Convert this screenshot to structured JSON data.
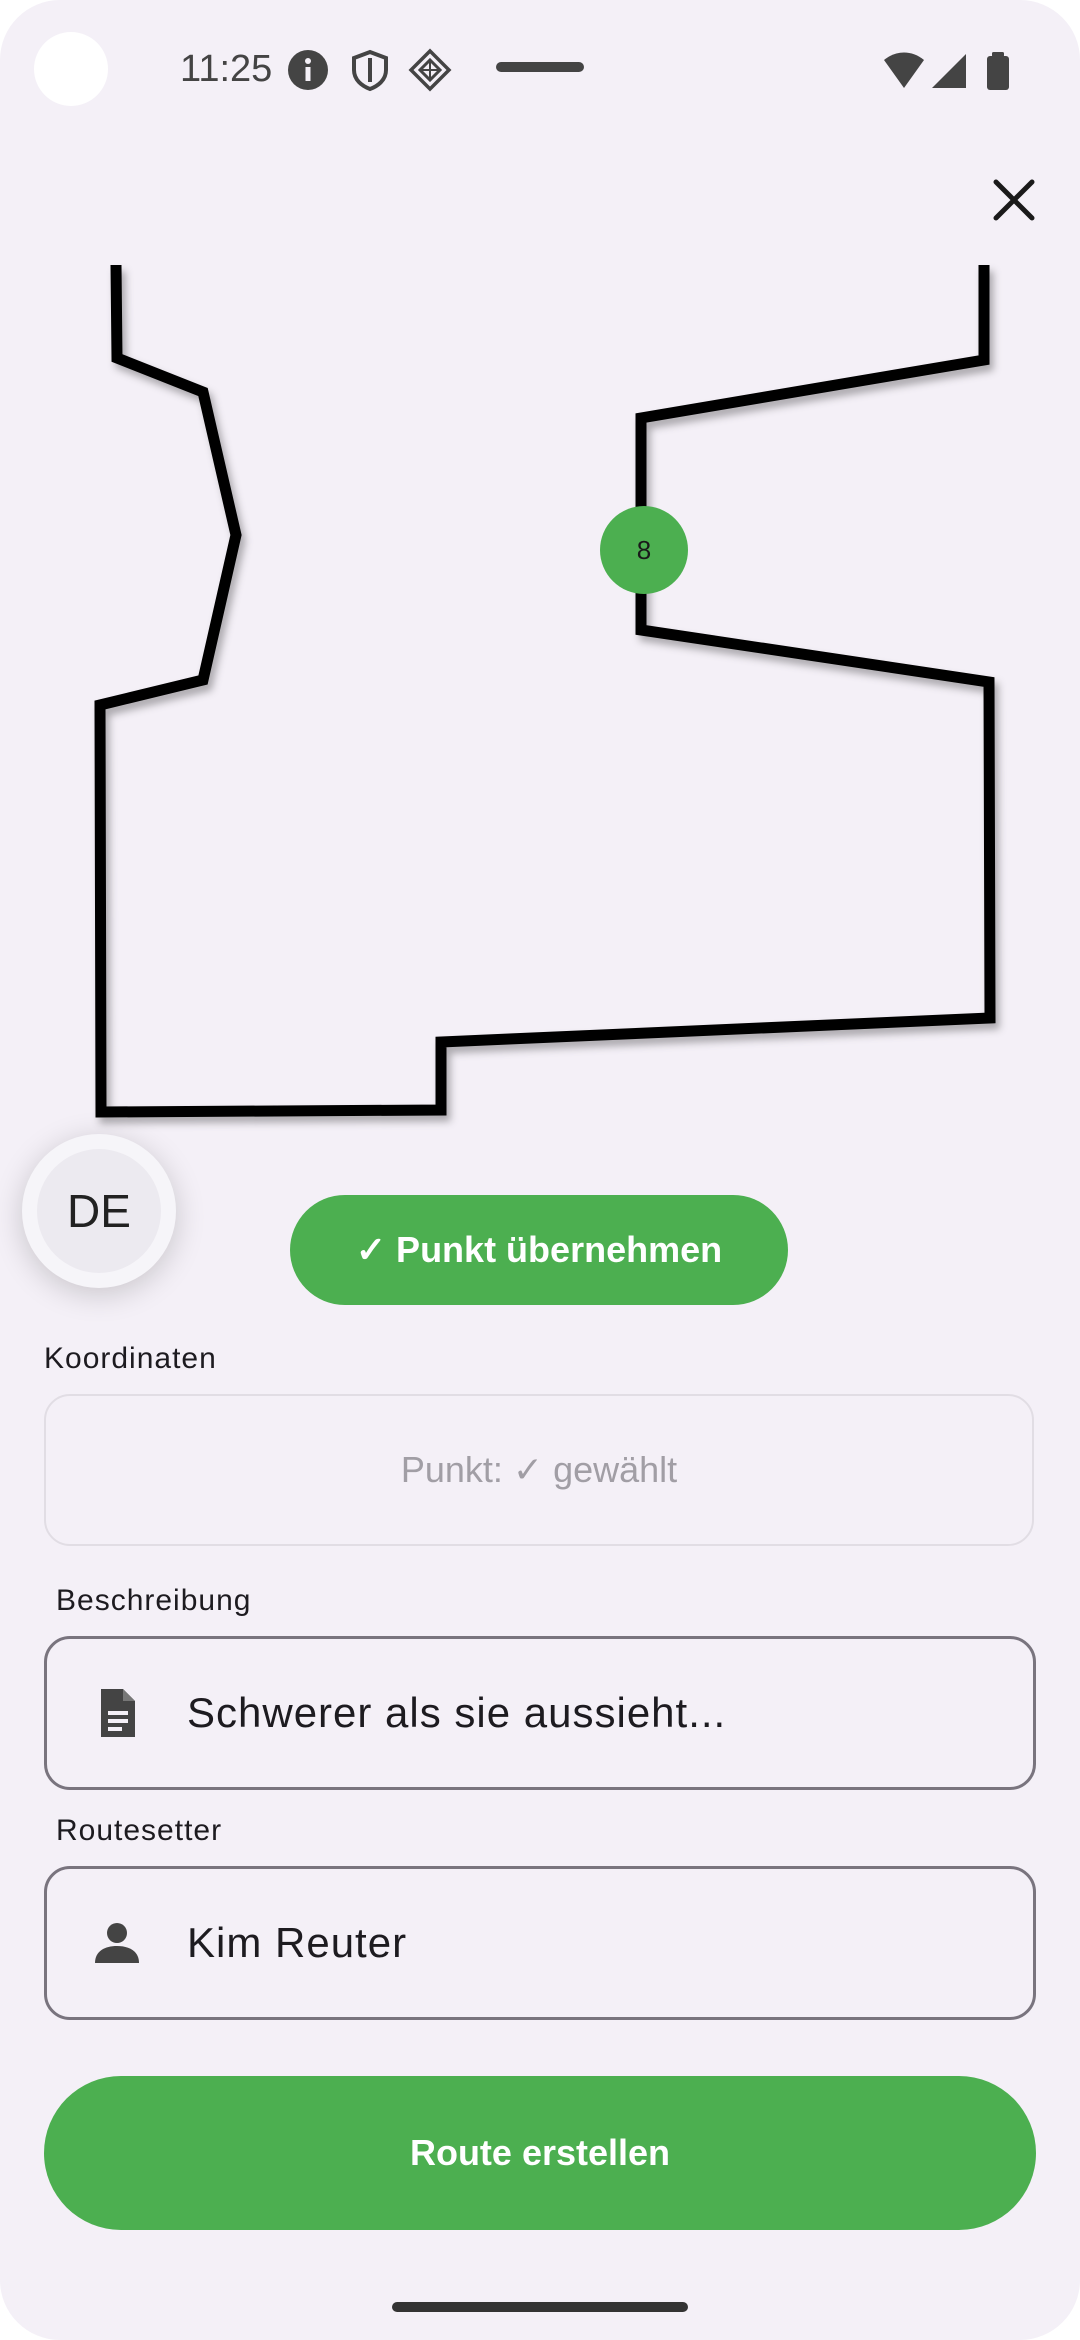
{
  "status_bar": {
    "time": "11:25"
  },
  "map": {
    "hold_marker_label": "8"
  },
  "language_chip": {
    "label": "DE"
  },
  "accept_point_button": {
    "label": "✓ Punkt übernehmen"
  },
  "coordinates": {
    "label": "Koordinaten",
    "value": "Punkt: ✓ gewählt"
  },
  "description": {
    "label": "Beschreibung",
    "value": "Schwerer als sie aussieht..."
  },
  "routesetter": {
    "label": "Routesetter",
    "value": "Kim Reuter"
  },
  "create_button": {
    "label": "Route erstellen"
  },
  "colors": {
    "accent": "#4caf50",
    "background": "#f4f0f7",
    "outline": "#79747e"
  },
  "icons": {
    "close": "close-icon",
    "description": "document-icon",
    "routesetter": "person-icon"
  }
}
